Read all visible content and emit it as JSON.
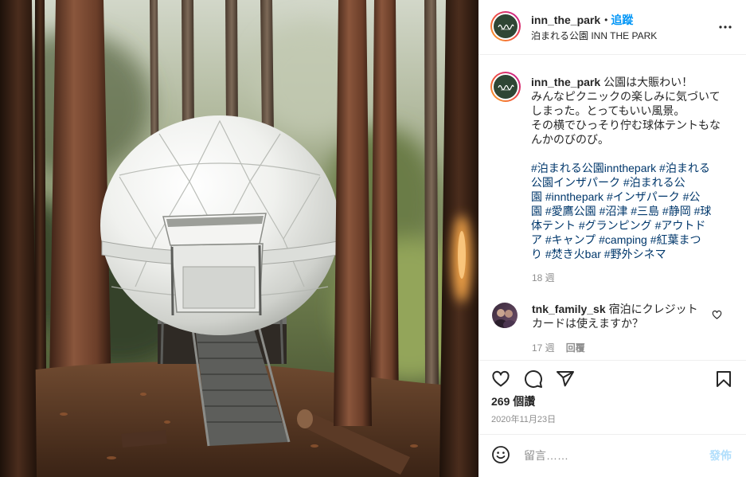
{
  "colors": {
    "text": "#262626",
    "muted": "#8e8e8e",
    "accent": "#0095f6",
    "hashtag": "#00376b",
    "post_disabled": "#b2dffc",
    "divider": "#efefef"
  },
  "header": {
    "avatar_icon": "inn-the-park-logo",
    "username": "inn_the_park",
    "separator": "•",
    "follow_label": "追蹤",
    "location": "泊まれる公園 INN THE PARK",
    "more_icon": "more-options-icon"
  },
  "caption": {
    "username": "inn_the_park",
    "body_lines": [
      "公園は大賑わい！",
      "みんなピクニックの楽しみに気づいて",
      "しまった。とってもいい風景。",
      "その横でひっそり佇む球体テントもな",
      "んかのびのび。"
    ],
    "hashtag_lines": [
      "#泊まれる公園innthepark #泊まれる",
      "公園インザパーク #泊まれる公",
      "園 #innthepark #インザパーク #公",
      "園 #愛鷹公園 #沼津 #三島 #静岡 #球",
      "体テント #グランピング #アウトド",
      "ア #キャンプ #camping #紅葉まつ",
      "り #焚き火bar #野外シネマ"
    ],
    "time": "18 週"
  },
  "comments": [
    {
      "username": "tnk_family_sk",
      "lines": [
        "宿泊にクレジット",
        "カードは使えますか？"
      ],
      "time": "17 週",
      "reply_label": "回覆",
      "like_icon": "heart-icon"
    }
  ],
  "actions": {
    "like_icon": "heart-icon",
    "comment_icon": "comment-icon",
    "share_icon": "paper-plane-icon",
    "save_icon": "bookmark-icon"
  },
  "likes": "269 個讚",
  "date": "2020年11月23日",
  "add_comment": {
    "emoji_icon": "smiley-icon",
    "placeholder": "留言……",
    "post_label": "發佈"
  }
}
